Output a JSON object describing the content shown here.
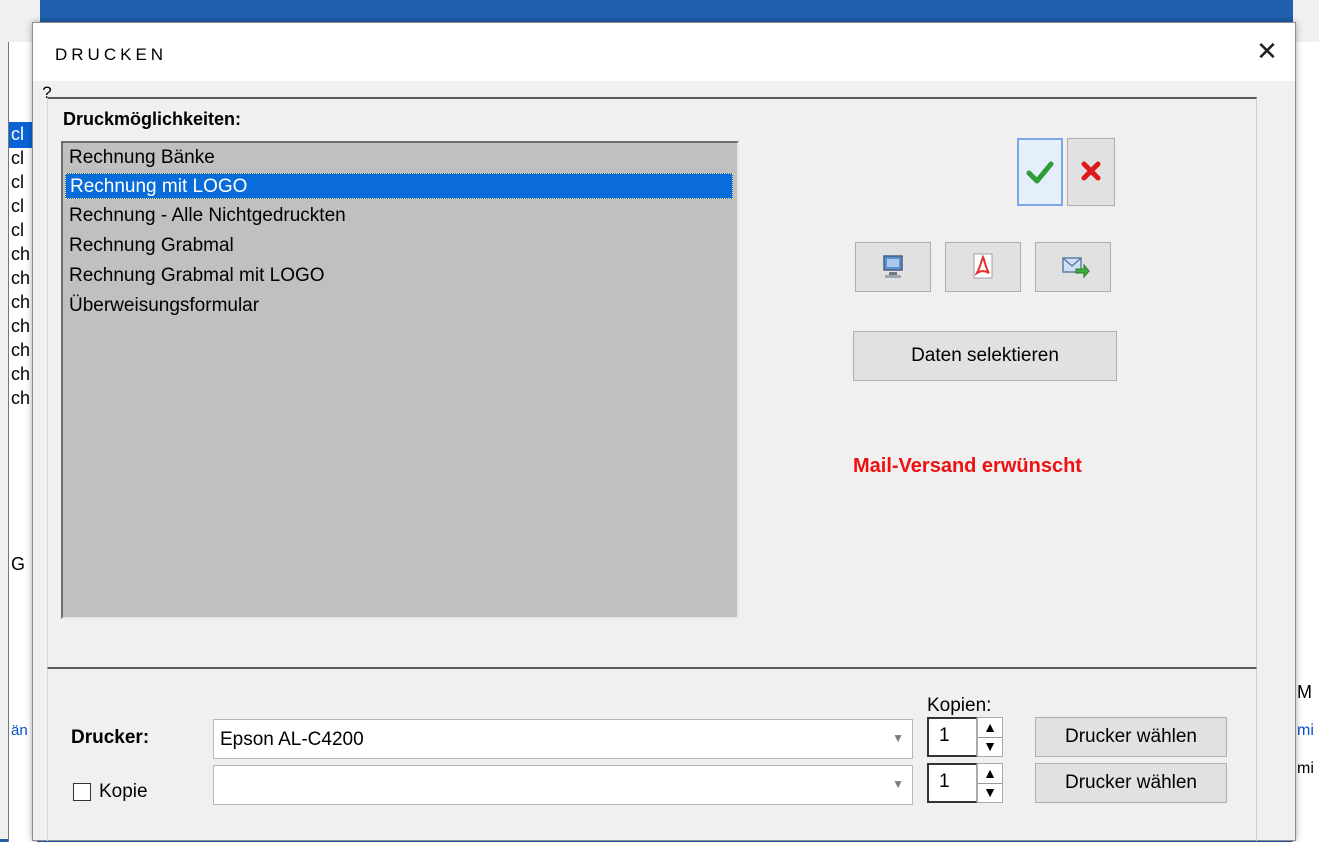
{
  "background": {
    "left_rows": [
      "cl",
      "cl",
      "cl",
      "cl",
      "cl",
      "ch",
      "ch",
      "ch",
      "ch",
      "ch",
      "ch",
      "ch",
      "G"
    ],
    "right_cells": [
      "M",
      "mi",
      "mi"
    ],
    "left_bottom": "än"
  },
  "dialog": {
    "title": "DRUCKEN",
    "close_glyph": "✕",
    "help_glyph": "?",
    "options_label": "Druckmöglichkeiten:",
    "options": [
      "Rechnung Bänke",
      "Rechnung mit LOGO",
      "Rechnung - Alle Nichtgedruckten",
      "Rechnung Grabmal",
      "Rechnung Grabmal mit LOGO",
      "Überweisungsformular"
    ],
    "selected_option": "Rechnung mit LOGO",
    "select_data_label": "Daten selektieren",
    "mail_notice": "Mail-Versand erwünscht",
    "copies_label": "Kopien:",
    "printer_label": "Drucker:",
    "printer_value": "Epson AL-C4200",
    "printer_copies": "1",
    "choose_printer_label": "Drucker wählen",
    "copy_label": "Kopie",
    "copy_value": "",
    "copy_copies": "1",
    "copy_checked": false
  },
  "colors": {
    "accent": "#0a6cd8",
    "mail_notice": "#ef1111",
    "list_bg": "#c0c0c0",
    "dialog_bg": "#f0f0f0"
  },
  "icons": {
    "ok": "checkmark-icon",
    "cancel": "x-icon",
    "screen": "monitor-icon",
    "pdf": "pdf-icon",
    "mail": "mail-send-icon"
  }
}
